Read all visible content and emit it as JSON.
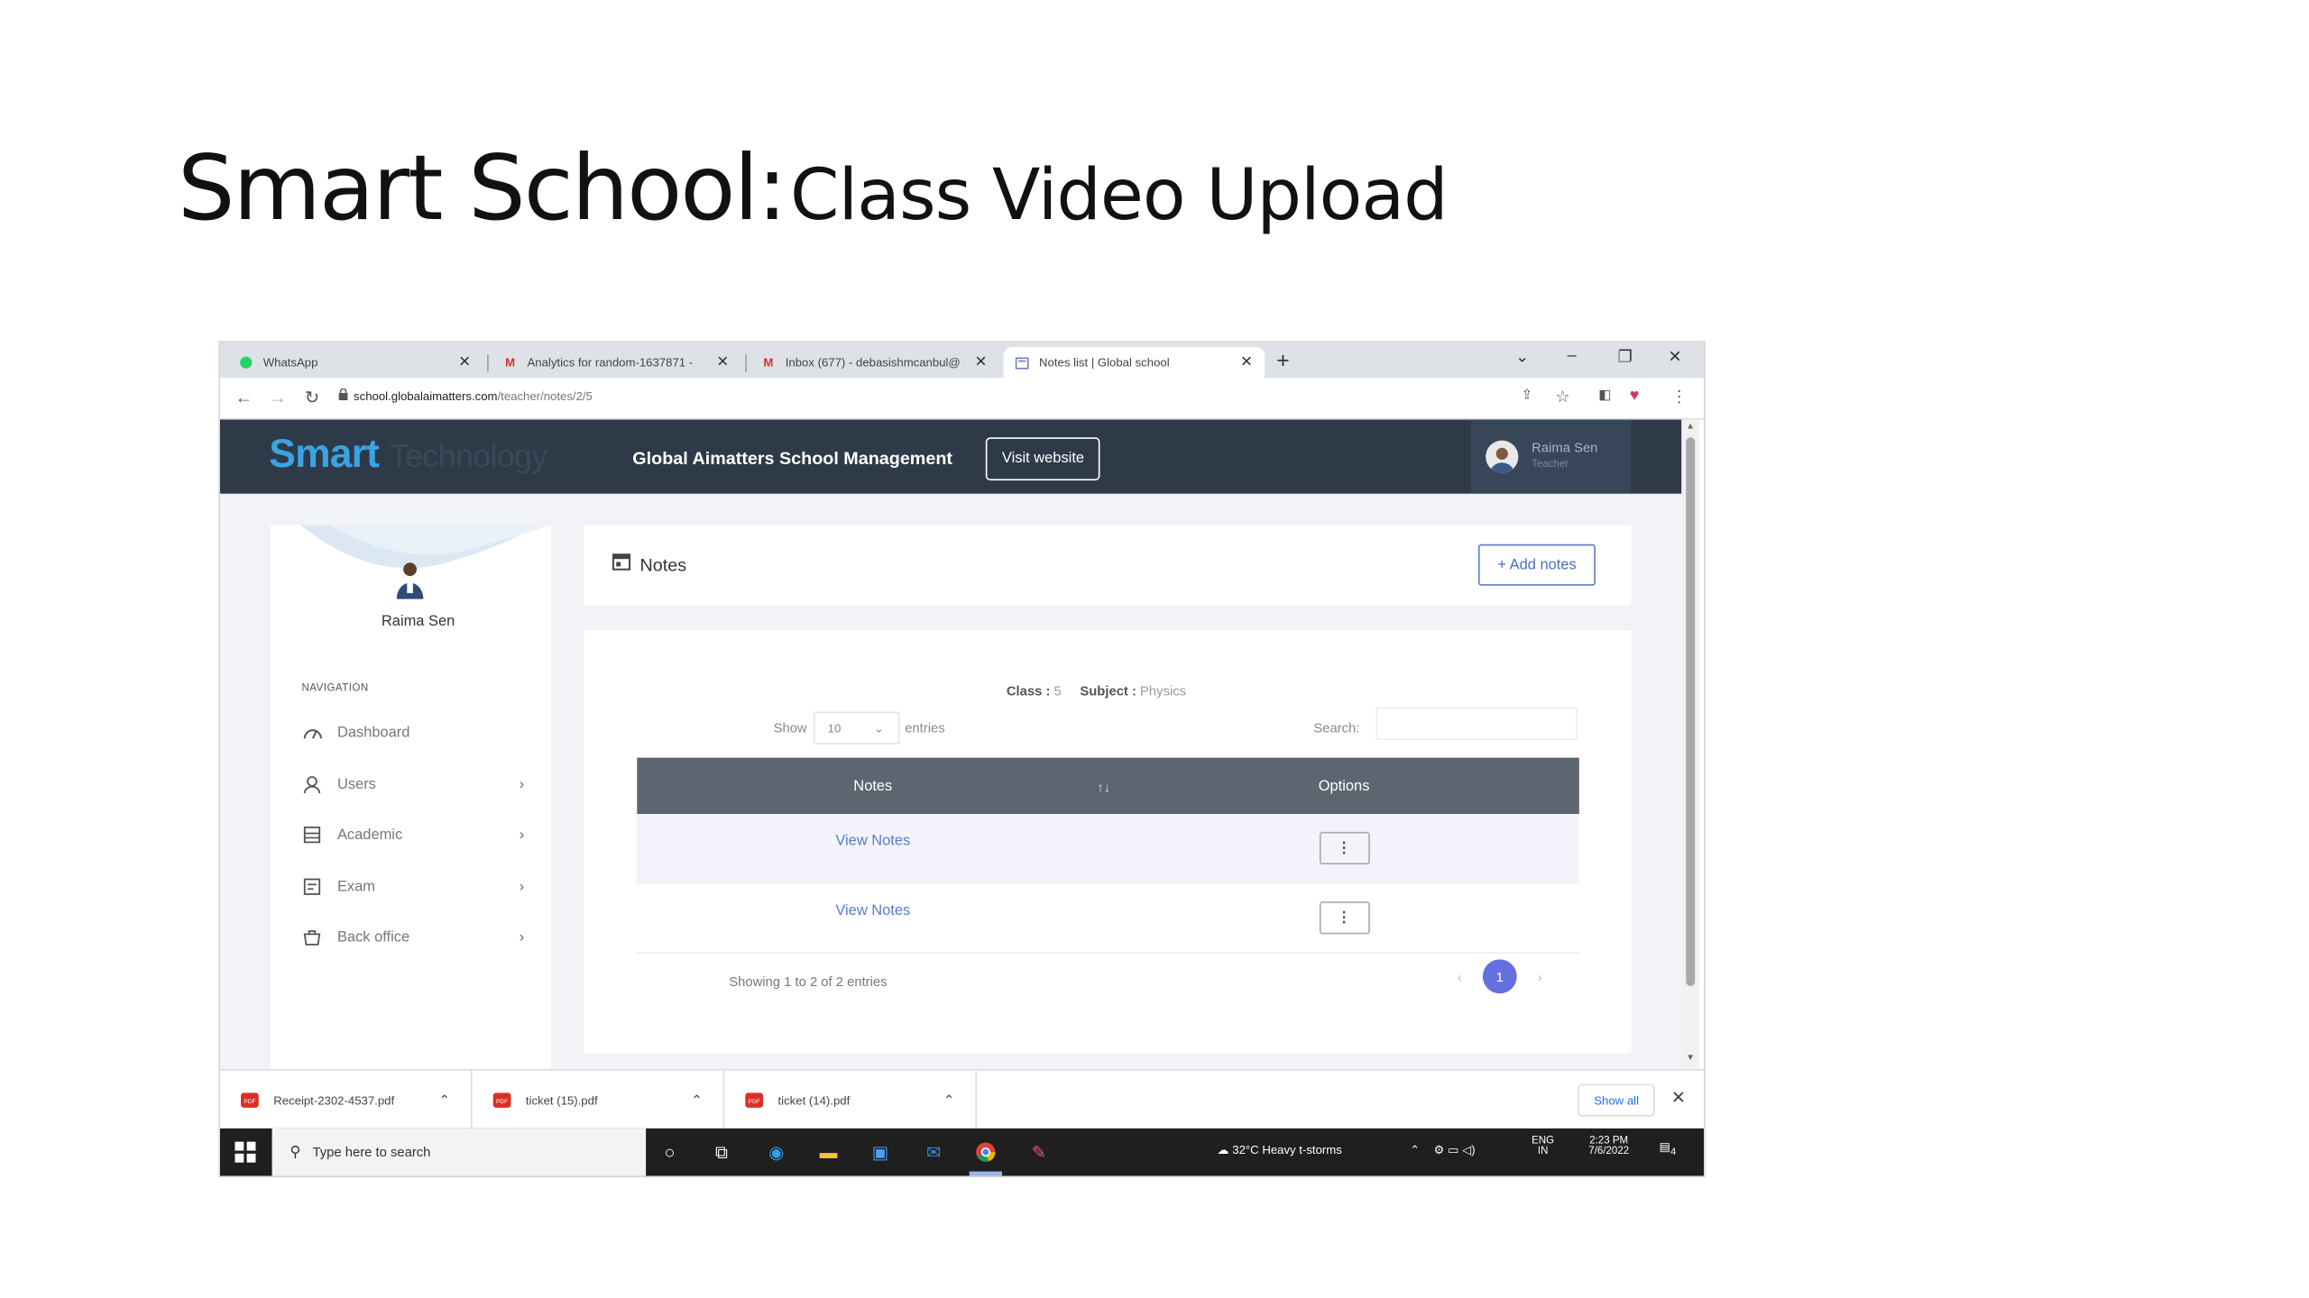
{
  "slide": {
    "title_main": "Smart School:",
    "title_sub": "Class Video Upload"
  },
  "browser": {
    "tabs": [
      {
        "label": "WhatsApp",
        "icon": "whatsapp-icon",
        "active": false
      },
      {
        "label": "Analytics for random-1637871 -",
        "icon": "gmail-icon",
        "active": false
      },
      {
        "label": "Inbox (677) - debasishmcanbul@",
        "icon": "gmail-icon",
        "active": false
      },
      {
        "label": "Notes list | Global school",
        "icon": "page-icon",
        "active": true
      }
    ],
    "new_tab": "+",
    "url_host": "school.globalaimatters.com",
    "url_path": "/teacher/notes/2/5"
  },
  "app": {
    "logo": "Smart",
    "logo_rest": "Technology",
    "school_name": "Global Aimatters School Management",
    "visit_website": "Visit website",
    "user_name": "Raima Sen",
    "user_role": "Teacher"
  },
  "sidebar": {
    "profile_name": "Raima Sen",
    "nav_label": "NAVIGATION",
    "items": [
      {
        "label": "Dashboard",
        "icon": "dashboard-icon",
        "has_children": false
      },
      {
        "label": "Users",
        "icon": "user-icon",
        "has_children": true
      },
      {
        "label": "Academic",
        "icon": "academic-icon",
        "has_children": true
      },
      {
        "label": "Exam",
        "icon": "exam-icon",
        "has_children": true
      },
      {
        "label": "Back office",
        "icon": "backoffice-icon",
        "has_children": true
      }
    ]
  },
  "notes": {
    "title": "Notes",
    "add_button": "+ Add notes",
    "class_label": "Class :",
    "class_value": "5",
    "subject_label": "Subject :",
    "subject_value": "Physics",
    "show_label": "Show",
    "show_value": "10",
    "entries_label": "entries",
    "search_label": "Search:",
    "search_value": "",
    "columns": [
      "Notes",
      "Options"
    ],
    "rows": [
      {
        "link": "View Notes"
      },
      {
        "link": "View Notes"
      }
    ],
    "showing": "Showing 1 to 2 of 2 entries",
    "current_page": "1"
  },
  "downloads": {
    "files": [
      "Receipt-2302-4537.pdf",
      "ticket (15).pdf",
      "ticket (14).pdf"
    ],
    "show_all": "Show all"
  },
  "taskbar": {
    "search_placeholder": "Type here to search",
    "weather": "32°C  Heavy t-storms",
    "lang": "ENG",
    "region": "IN",
    "time": "2:23 PM",
    "date": "7/6/2022",
    "notifications": "4"
  },
  "colors": {
    "header_bg": "#2e3a48",
    "logo_blue": "#3aa3e3",
    "table_head": "#5c6670",
    "link_blue": "#5a7ad0",
    "page_active": "#6470e0"
  }
}
